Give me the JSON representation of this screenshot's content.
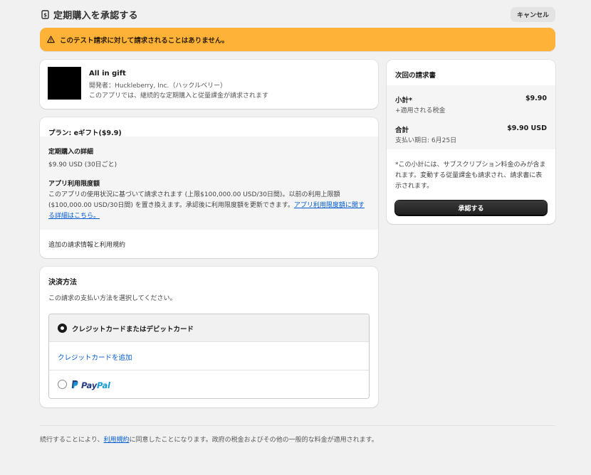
{
  "header": {
    "title": "定期購入を承認する",
    "cancel_label": "キャンセル"
  },
  "banner": {
    "text": "このテスト請求に対して請求されることはありません。"
  },
  "app": {
    "name": "All in gift",
    "developer": "開発者：Huckleberry, Inc.（ハックルベリー）",
    "description": "このアプリでは、継続的な定期購入と従量課金が請求されます"
  },
  "plan": {
    "title": "プラン: eギフト($9.9)",
    "details_heading": "定期購入の詳細",
    "details_value": "$9.90 USD (30日ごと)",
    "limit_heading": "アプリ利用限度額",
    "limit_text": "このアプリの使用状況に基づいて請求されます (上限$100,000.00 USD/30日間)。以前の利用上限額($100,000.00 USD/30日間) を置き換えます。承認後に利用限度額を更新できます。",
    "limit_link": "アプリ利用限度額に関する詳細はこちら。",
    "terms": "追加の請求情報と利用規約"
  },
  "payment": {
    "title": "決済方法",
    "subtitle": "この請求の支払い方法を選択してください。",
    "option_card": "クレジットカードまたはデビットカード",
    "add_card": "クレジットカードを追加",
    "paypal_part1": "Pay",
    "paypal_part2": "Pal"
  },
  "bill": {
    "title": "次回の請求書",
    "subtotal_label": "小計*",
    "subtotal_value": "$9.90",
    "tax_label": "+適用される税金",
    "total_label": "合計",
    "total_value": "$9.90 USD",
    "due_date": "支払い期日: 6月25日",
    "note": "*この小計には、サブスクリプション料金のみが含まれます。変動する従量課金も請求され、請求書に表示されます。",
    "approve_label": "承認する"
  },
  "footer": {
    "text_before": "続行することにより、",
    "link": "利用規約",
    "text_after": "に同意したことになります。政府の税金およびその他の一般的な料金が適用されます。"
  },
  "colors": {
    "banner": "#ffb238",
    "link": "#005bd3",
    "paypal_dark": "#253b80",
    "paypal_light": "#179bd7"
  }
}
